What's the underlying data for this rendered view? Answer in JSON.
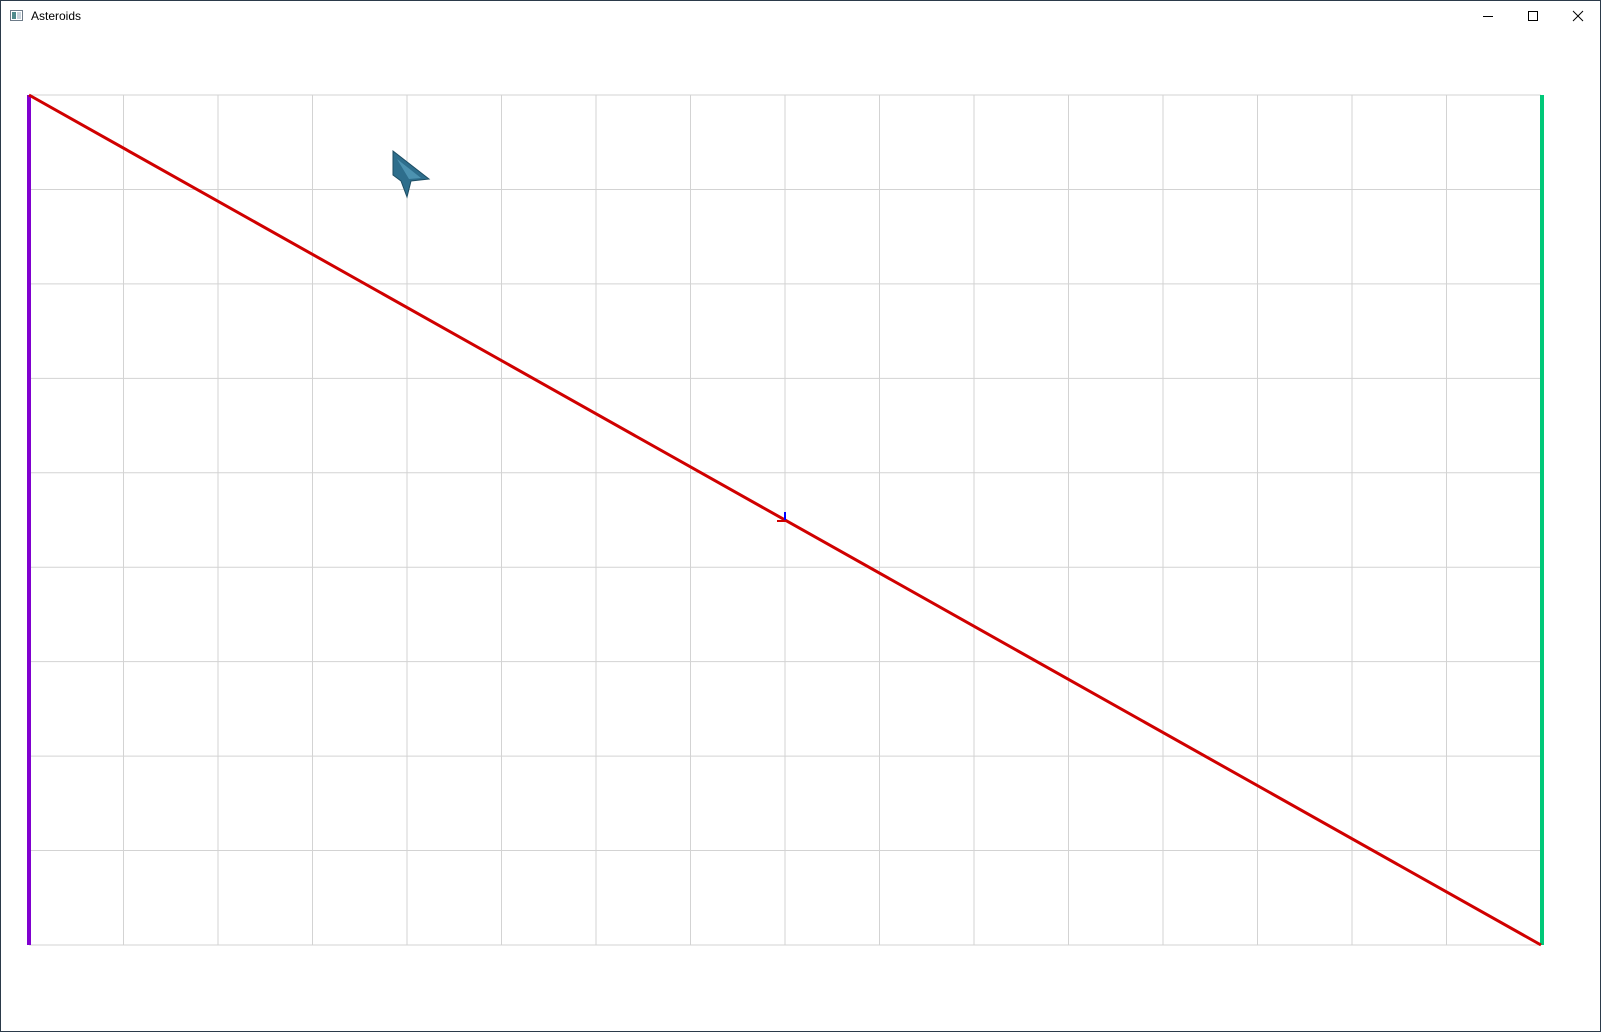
{
  "window": {
    "title": "Asteroids",
    "icon": "app-window-icon",
    "controls": {
      "minimize_icon": "minimize-icon",
      "maximize_icon": "maximize-icon",
      "close_icon": "close-icon"
    }
  },
  "game": {
    "grid": {
      "columns": 16,
      "rows": 9,
      "line_color": "#d3d3d3"
    },
    "boundaries": {
      "left_wall_color": "#8000d0",
      "right_wall_color": "#00c878",
      "diagonal_color": "#d00000"
    },
    "origin_marker_color": "#0000ff",
    "ship": {
      "icon": "spaceship-icon",
      "color": "#2e6e8c"
    }
  }
}
